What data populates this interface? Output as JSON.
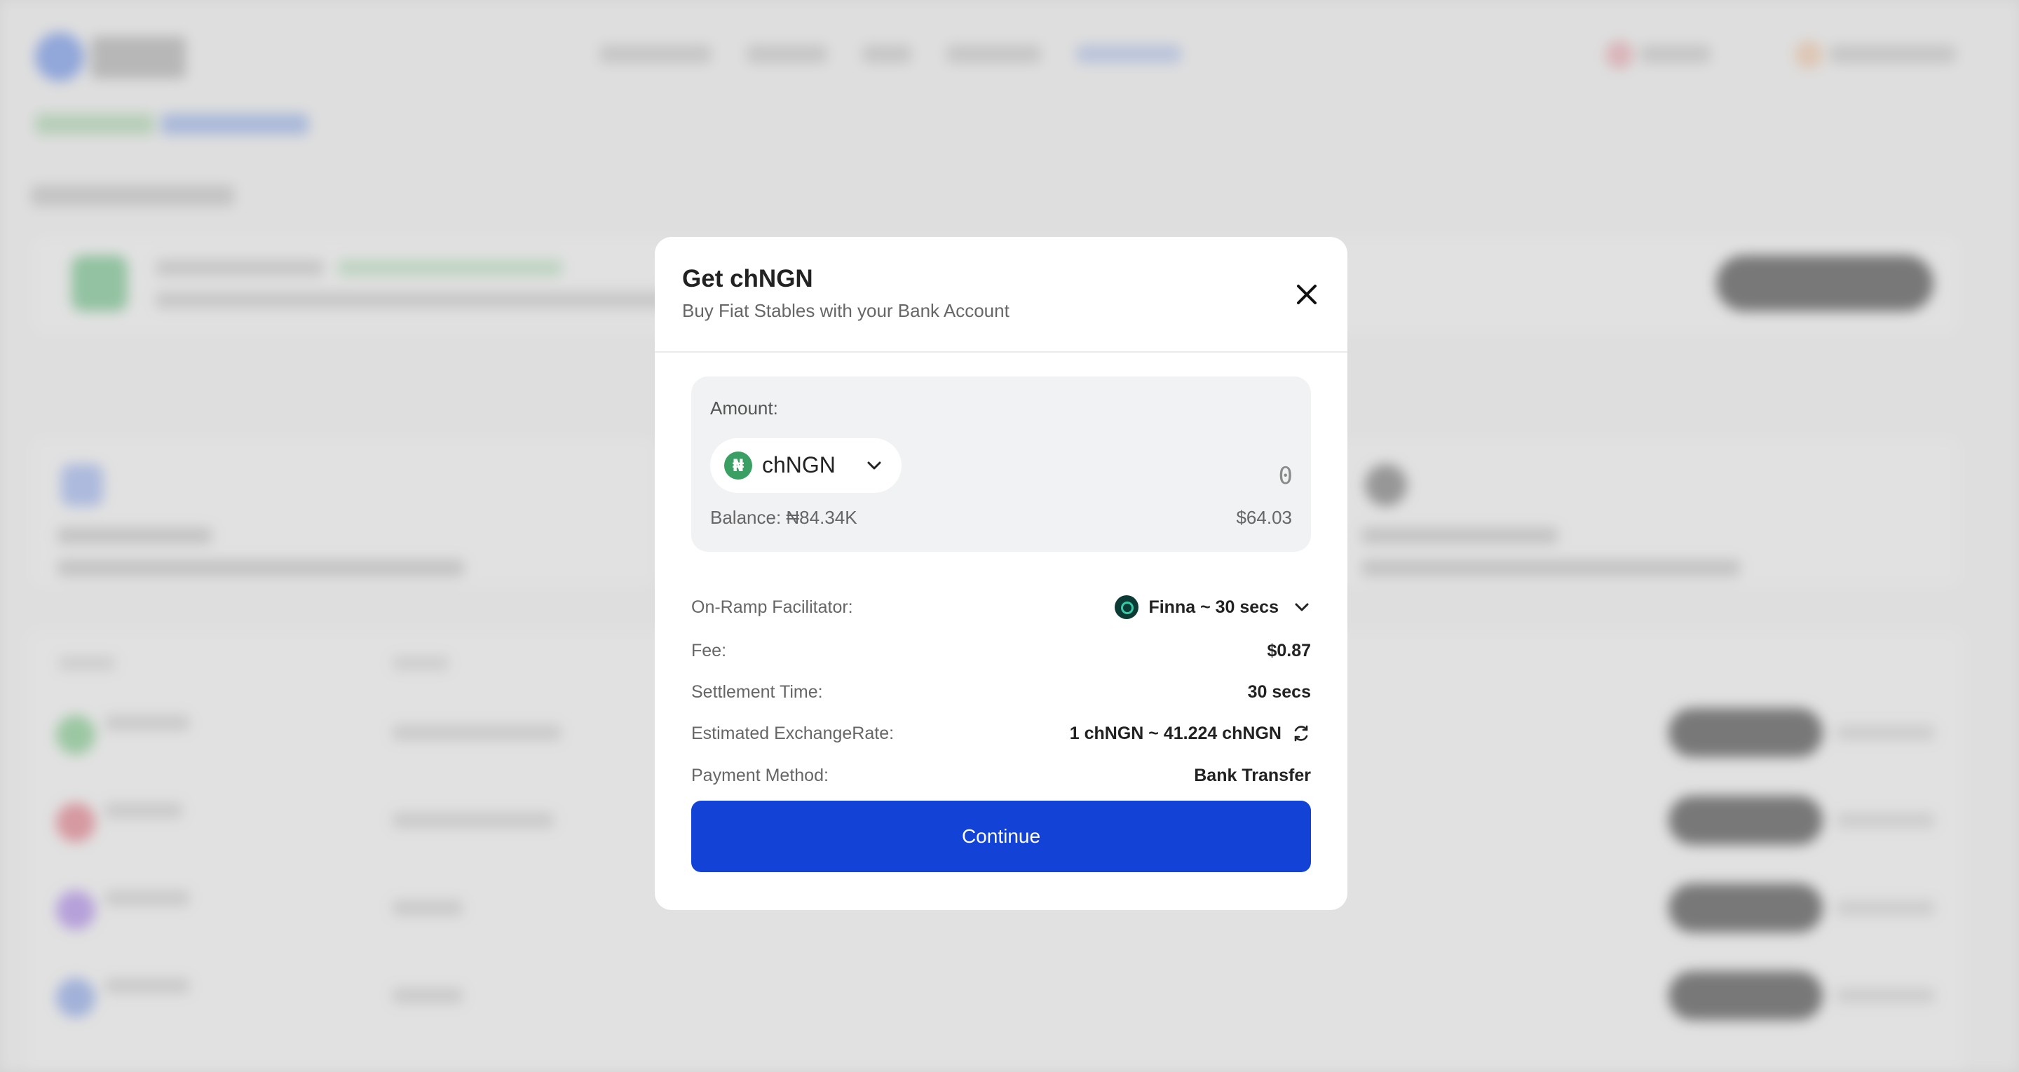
{
  "modal": {
    "title": "Get chNGN",
    "subtitle": "Buy Fiat Stables with your Bank Account",
    "amount_label": "Amount:",
    "token": {
      "name": "chNGN",
      "icon": "naira-icon",
      "icon_color": "#3a9f63"
    },
    "amount_input": {
      "value": "",
      "placeholder": "0"
    },
    "balance_text": "Balance: ₦84.34K",
    "usd_value": "$64.03",
    "details": {
      "facilitator_label": "On-Ramp Facilitator:",
      "facilitator_value": "Finna ~ 30 secs",
      "fee_label": "Fee:",
      "fee_value": "$0.87",
      "settlement_label": "Settlement Time:",
      "settlement_value": "30 secs",
      "rate_label": "Estimated ExchangeRate:",
      "rate_value": "1 chNGN ~ 41.224 chNGN",
      "payment_label": "Payment Method:",
      "payment_value": "Bank Transfer"
    },
    "continue_label": "Continue",
    "accent_color": "#1342d6"
  }
}
